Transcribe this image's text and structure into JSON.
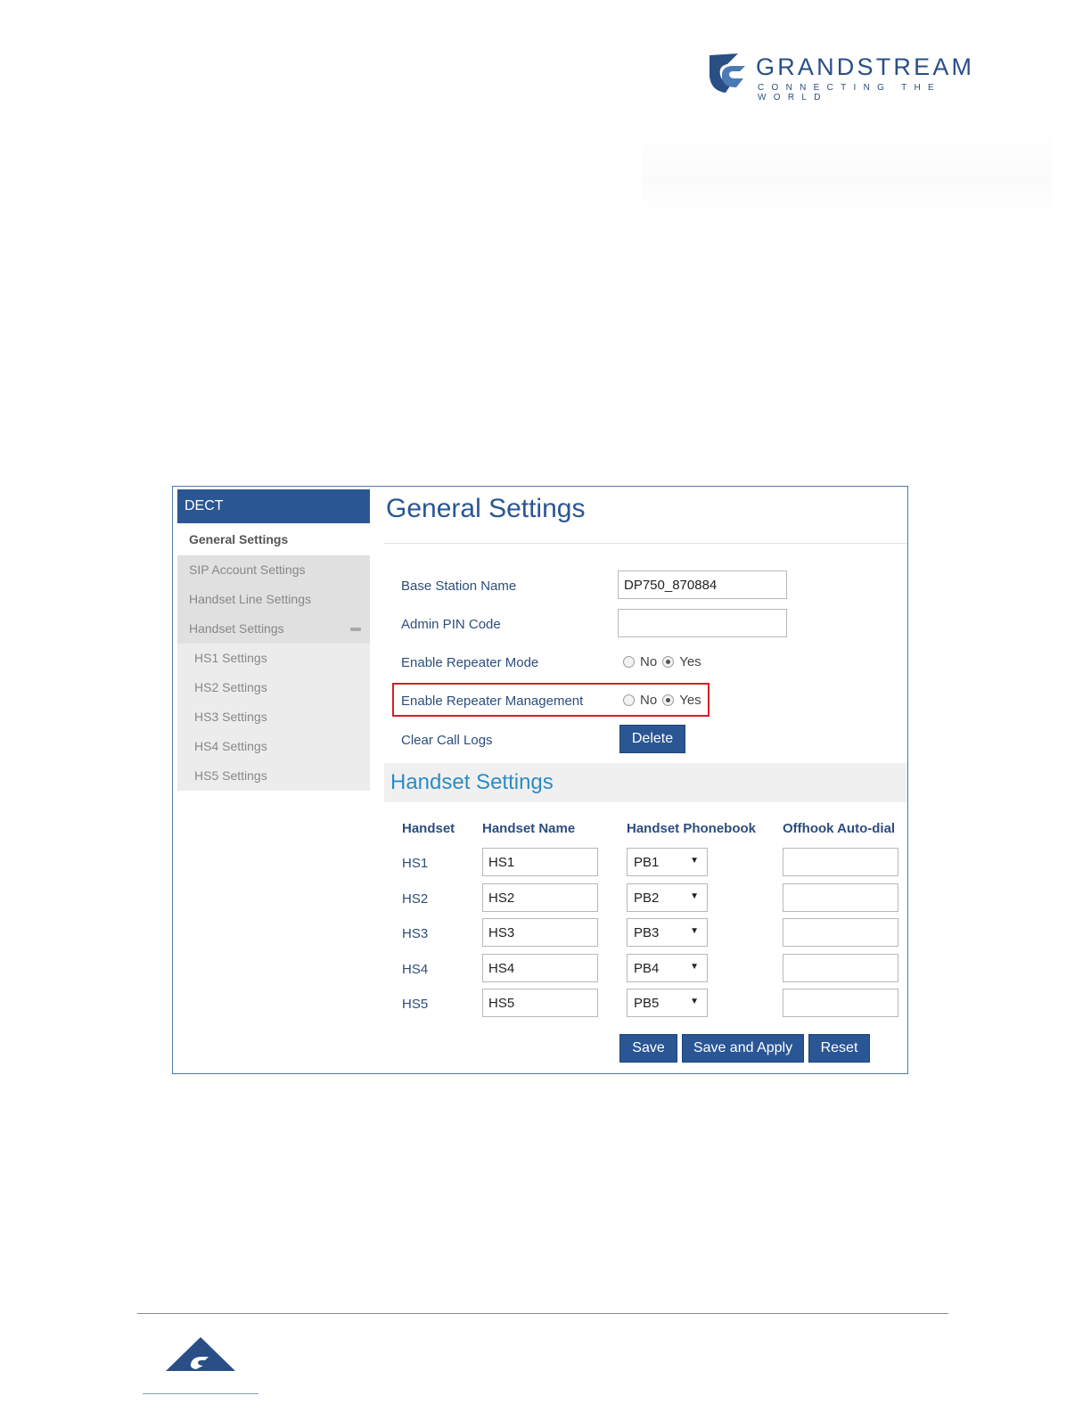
{
  "brand": {
    "name": "GRANDSTREAM",
    "tagline": "CONNECTING THE WORLD",
    "color": "#2a4f86"
  },
  "sidebar": {
    "header": "DECT",
    "items": [
      {
        "label": "General Settings",
        "active": true
      },
      {
        "label": "SIP Account Settings"
      },
      {
        "label": "Handset Line Settings"
      },
      {
        "label": "Handset Settings",
        "expanded": true
      }
    ],
    "subitems": [
      "HS1 Settings",
      "HS2 Settings",
      "HS3 Settings",
      "HS4 Settings",
      "HS5 Settings"
    ]
  },
  "main": {
    "title": "General Settings",
    "form": {
      "base_station_name": {
        "label": "Base Station Name",
        "value": "DP750_870884"
      },
      "admin_pin": {
        "label": "Admin PIN Code",
        "value": ""
      },
      "repeater_mode": {
        "label": "Enable Repeater Mode",
        "no": "No",
        "yes": "Yes",
        "selected": "Yes"
      },
      "repeater_management": {
        "label": "Enable Repeater Management",
        "no": "No",
        "yes": "Yes",
        "selected": "Yes"
      },
      "clear_call_logs": {
        "label": "Clear Call Logs",
        "button": "Delete"
      }
    },
    "handset_section": {
      "title": "Handset Settings",
      "columns": [
        "Handset",
        "Handset Name",
        "Handset Phonebook",
        "Offhook Auto-dial"
      ],
      "rows": [
        {
          "handset": "HS1",
          "name": "HS1",
          "phonebook": "PB1",
          "autodial": ""
        },
        {
          "handset": "HS2",
          "name": "HS2",
          "phonebook": "PB2",
          "autodial": ""
        },
        {
          "handset": "HS3",
          "name": "HS3",
          "phonebook": "PB3",
          "autodial": ""
        },
        {
          "handset": "HS4",
          "name": "HS4",
          "phonebook": "PB4",
          "autodial": ""
        },
        {
          "handset": "HS5",
          "name": "HS5",
          "phonebook": "PB5",
          "autodial": ""
        }
      ]
    },
    "actions": {
      "save": "Save",
      "save_apply": "Save and Apply",
      "reset": "Reset"
    }
  },
  "colors": {
    "accent": "#2a5694",
    "highlight": "#d21f26",
    "section_title": "#2a8cc7"
  }
}
